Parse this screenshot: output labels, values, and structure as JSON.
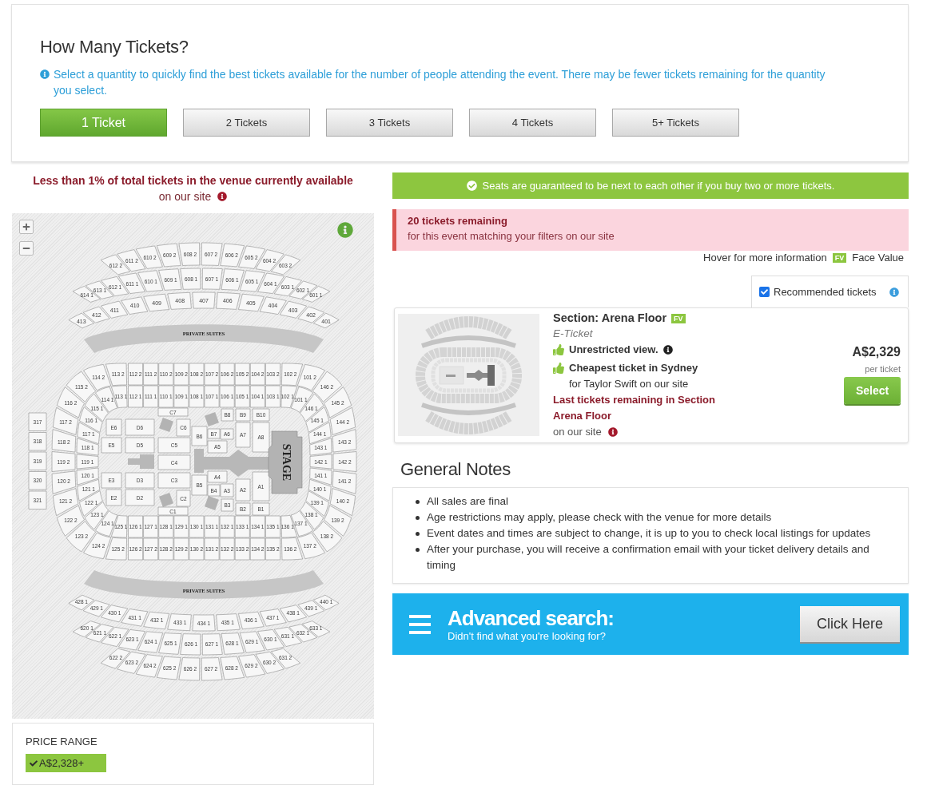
{
  "ticket_quantity": {
    "title": "How Many Tickets?",
    "hint": "Select a quantity to quickly find the best tickets available for the number of people attending the event. There may be fewer tickets remaining for the quantity you select.",
    "options": [
      {
        "label": "1 Ticket",
        "selected": true
      },
      {
        "label": "2 Tickets",
        "selected": false
      },
      {
        "label": "3 Tickets",
        "selected": false
      },
      {
        "label": "4 Tickets",
        "selected": false
      },
      {
        "label": "5+ Tickets",
        "selected": false
      }
    ]
  },
  "availability": {
    "text": "Less than 1% of total tickets in the venue currently available",
    "suffix": "on our site"
  },
  "seat_map": {
    "top_upper_back": [
      "612 2",
      "611 2",
      "610 2",
      "609 2",
      "608 2",
      "607 2",
      "606 2",
      "605 2",
      "604 2",
      "603 2"
    ],
    "top_upper_front": [
      "614 1",
      "613 1",
      "612 1",
      "611 1",
      "610 1",
      "609 1",
      "608 1",
      "607 1",
      "606 1",
      "605 1",
      "604 1",
      "603 1",
      "602 1",
      "601 1"
    ],
    "top_400": [
      "413",
      "412",
      "411",
      "410",
      "409",
      "408",
      "407",
      "406",
      "405",
      "404",
      "403",
      "402",
      "401"
    ],
    "top_suites": "PRIVATE SUITES",
    "left_300": [
      "317",
      "318",
      "319",
      "320",
      "321"
    ],
    "bowl_top_back": [
      "112 2",
      "111 2",
      "110 2",
      "109 2",
      "108 2",
      "107 2",
      "106 2",
      "105 2",
      "104 2",
      "103 2"
    ],
    "bowl_top_front": [
      "112 1",
      "111 1",
      "110 1",
      "109 1",
      "108 1",
      "107 1",
      "106 1",
      "105 1",
      "104 1",
      "103 1"
    ],
    "bowl_left_back": [
      "113 2",
      "114 2",
      "115 2",
      "116 2",
      "117 2",
      "118 2",
      "119 2",
      "120 2",
      "121 2",
      "122 2",
      "123 2",
      "124 2",
      "125 2"
    ],
    "bowl_left_front": [
      "113 1",
      "114 1",
      "115 1",
      "116 1",
      "117 1",
      "118 1",
      "119 1",
      "120 1",
      "121 1",
      "122 1",
      "123 1",
      "124 1",
      "125 1"
    ],
    "bowl_right_back": [
      "102 2",
      "101 2",
      "146 2",
      "145 2",
      "144 2",
      "143 2",
      "142 2",
      "141 2",
      "140 2",
      "139 2",
      "138 2",
      "137 2",
      "136 2"
    ],
    "bowl_right_front": [
      "102 1",
      "101 1",
      "146 1",
      "145 1",
      "144 1",
      "143 1",
      "142 1",
      "141 1",
      "140 1",
      "139 1",
      "138 1",
      "137 1",
      "136 1"
    ],
    "floor": [
      "E6",
      "D6",
      "C7",
      "C6",
      "E5",
      "D5",
      "C5",
      "C4",
      "E3",
      "D3",
      "C3",
      "E2",
      "D2",
      "C2",
      "C1",
      "B8",
      "B9",
      "B10",
      "B6",
      "B7",
      "A6",
      "A5",
      "A7",
      "A8",
      "A4",
      "A3",
      "B5",
      "B4",
      "B3",
      "A2",
      "A1",
      "B2",
      "B1"
    ],
    "stage": "STAGE",
    "bowl_bottom_front": [
      "126 1",
      "127 1",
      "128 1",
      "129 1",
      "130 1",
      "131 1",
      "132 1",
      "133 1",
      "134 1",
      "135 1"
    ],
    "bowl_bottom_back": [
      "126 2",
      "127 2",
      "128 2",
      "129 2",
      "130 2",
      "131 2",
      "132 2",
      "133 2",
      "134 2",
      "135 2"
    ],
    "bottom_suites": "PRIVATE SUITES",
    "bottom_400": [
      "428 1",
      "429 1",
      "430 1",
      "431 1",
      "432 1",
      "433 1",
      "434 1",
      "435 1",
      "436 1",
      "437 1",
      "438 1",
      "439 1",
      "440 1"
    ],
    "bottom_upper_front": [
      "620 1",
      "621 1",
      "622 1",
      "623 1",
      "624 1",
      "625 1",
      "626 1",
      "627 1",
      "628 1",
      "629 1",
      "630 1",
      "631 1",
      "632 1",
      "633 1"
    ],
    "bottom_upper_back": [
      "622 2",
      "623 2",
      "624 2",
      "625 2",
      "626 2",
      "627 2",
      "628 2",
      "629 2",
      "630 2",
      "631 2"
    ]
  },
  "price_range": {
    "label": "PRICE RANGE",
    "value": "A$2,328+"
  },
  "guarantee_banner": "Seats are guaranteed to be next to each other if you buy two or more tickets.",
  "remaining_alert": {
    "title": "20 tickets remaining",
    "text": "for this event matching your filters on our site"
  },
  "legend": {
    "hint": "Hover for more information",
    "badge": "FV",
    "label": "Face Value"
  },
  "recommended_filter": {
    "label": "Recommended tickets",
    "checked": true
  },
  "listing": {
    "section": "Section: Arena Floor",
    "badge": "FV",
    "delivery": "E-Ticket",
    "features": [
      {
        "title": "Unrestricted view.",
        "info": true
      },
      {
        "title": "Cheapest ticket in Sydney",
        "info": false,
        "detail": "for Taylor Swift on our site"
      }
    ],
    "last_tickets": {
      "text": "Last tickets remaining in Section Arena Floor",
      "suffix": "on our site"
    },
    "price": "A$2,329",
    "price_unit": "per ticket",
    "action": "Select"
  },
  "general_notes": {
    "title": "General Notes",
    "items": [
      "All sales are final",
      "Age restrictions may apply, please check with the venue for more details",
      "Event dates and times are subject to change, it is up to you to check local listings for updates",
      "After your purchase, you will receive a confirmation email with your ticket delivery details and timing"
    ]
  },
  "advanced_search": {
    "title": "Advanced search:",
    "subtitle": "Didn't find what you're looking for?",
    "action": "Click Here"
  }
}
